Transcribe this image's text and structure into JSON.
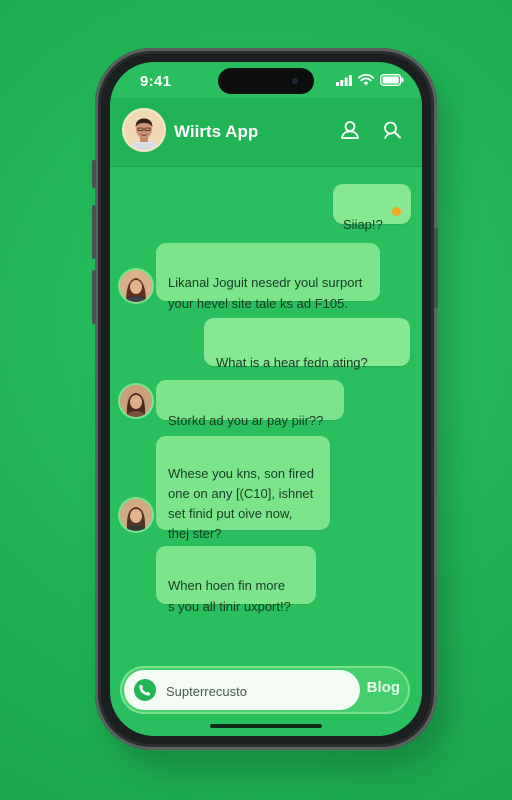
{
  "status_bar": {
    "time": "9:41",
    "icons": [
      "signal-icon",
      "wifi-icon",
      "battery-icon"
    ]
  },
  "header": {
    "title": "Wiirts App",
    "avatar_icon": "profile-avatar",
    "actions": [
      {
        "name": "contact-icon"
      },
      {
        "name": "search-icon"
      }
    ]
  },
  "messages": [
    {
      "direction": "out",
      "text": "Siiap!?"
    },
    {
      "direction": "in",
      "text": "Likanal Joguit nesedr youl surport\nyour hevel site tale ks ad F105."
    },
    {
      "direction": "out",
      "text": "What is a hear fedn ating?"
    },
    {
      "direction": "in",
      "text": "Storkd ad you ar pay piir??"
    },
    {
      "direction": "in",
      "text": "Whese you kns, son fired\none on any [(C10], ishnet\nset finid put oive now,\nthej ster?"
    },
    {
      "direction": "in",
      "text": "When hoen fin more\ns you all tinir uxport!?"
    }
  ],
  "composer": {
    "placeholder": "Supterrecusto",
    "value": "",
    "send_label": "Blog"
  },
  "colors": {
    "background": "#22b556",
    "bubble": "#7ce58b",
    "header": "#21b455",
    "accent_emoji": "#f5a623"
  }
}
